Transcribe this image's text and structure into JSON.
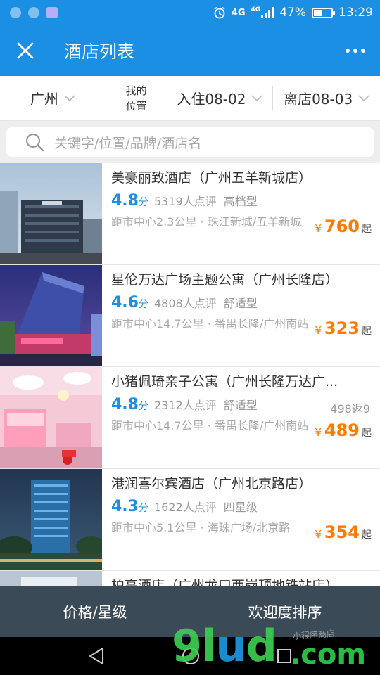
{
  "status_bar": {
    "network": "4G",
    "network_small": "4G",
    "battery": "47%",
    "time": "13:29"
  },
  "nav": {
    "title": "酒店列表",
    "close_icon": "close-icon",
    "more_icon": "more-dots-icon"
  },
  "filters": {
    "city": "广州",
    "my_location_line1": "我的",
    "my_location_line2": "位置",
    "check_in": "入住08-02",
    "check_out": "离店08-03"
  },
  "search": {
    "placeholder": "关键字/位置/品牌/酒店名"
  },
  "hotels": [
    {
      "name": "美豪丽致酒店（广州五羊新城店）",
      "score": "4.8",
      "score_unit": "分",
      "reviews": "5319人点评",
      "type": "高档型",
      "promo": "",
      "distance": "距市中心2.3公里 · 珠江新城/五羊新城",
      "currency": "¥",
      "price": "760",
      "price_suffix": "起"
    },
    {
      "name": "星伦万达广场主题公寓（广州长隆店）",
      "score": "4.6",
      "score_unit": "分",
      "reviews": "4808人点评",
      "type": "舒适型",
      "promo": "",
      "distance": "距市中心14.7公里 · 番禺长隆/广州南站",
      "currency": "¥",
      "price": "323",
      "price_suffix": "起"
    },
    {
      "name": "小猪佩琦亲子公寓（广州长隆万达广...",
      "score": "4.8",
      "score_unit": "分",
      "reviews": "2312人点评",
      "type": "舒适型",
      "promo": "498返9",
      "distance": "距市中心14.7公里 · 番禺长隆/广州南站",
      "currency": "¥",
      "price": "489",
      "price_suffix": "起"
    },
    {
      "name": "港润喜尔宾酒店（广州北京路店）",
      "score": "4.3",
      "score_unit": "分",
      "reviews": "1622人点评",
      "type": "四星级",
      "promo": "",
      "distance": "距市中心5.1公里 · 海珠广场/北京路",
      "currency": "¥",
      "price": "354",
      "price_suffix": "起"
    },
    {
      "name": "柏高酒店（广州龙口西岗顶地铁站店）"
    }
  ],
  "bottom_bar": {
    "price_star": "价格/星级",
    "popularity_sort": "欢迎度排序"
  },
  "watermark": {
    "brand": "9lud",
    "domain": ".com",
    "sub": "小程序商店"
  },
  "colors": {
    "brand_blue": "#1a8fe3",
    "price_orange": "#ff7a00",
    "bottom_bar": "#3a4a56"
  }
}
